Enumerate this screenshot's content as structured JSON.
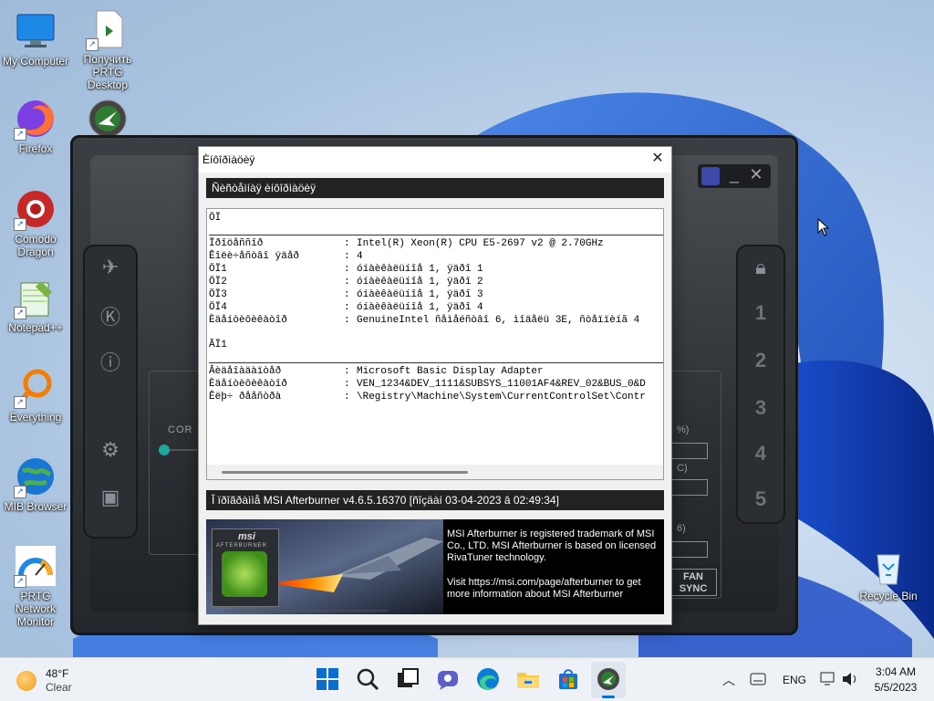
{
  "desktop": {
    "icons": [
      {
        "label": "My Computer"
      },
      {
        "label": "Получить PRTG Desktop"
      },
      {
        "label": "Firefox"
      },
      {
        "label": "Comodo Dragon"
      },
      {
        "label": "Notepad++"
      },
      {
        "label": "Everything"
      },
      {
        "label": "MIB Browser"
      },
      {
        "label": "PRTG Network Monitor"
      },
      {
        "label": "Recycle Bin"
      }
    ]
  },
  "afterburner": {
    "profile_numbers": [
      "1",
      "2",
      "3",
      "4",
      "5"
    ],
    "fan_sync_label": "FAN SYNC",
    "core_label": "COR",
    "pct_label_1": "%)",
    "pct_label_2": "C)",
    "pct_label_3": "6)"
  },
  "dialog": {
    "title": "Èíôîðìàöèÿ",
    "system_header": "Ñèñòåìíàÿ èíôîðìàöèÿ",
    "cpu_section": "ÖÏ",
    "cpu_rows": [
      {
        "key": "Ïðîöåññîð",
        "value": "Intel(R) Xeon(R) CPU E5-2697 v2 @ 2.70GHz"
      },
      {
        "key": "Êîëè÷åñòâî ÿäåð",
        "value": "4"
      },
      {
        "key": "ÖÏ1",
        "value": "óíàèêàëüíîå 1, ÿäðî 1"
      },
      {
        "key": "ÖÏ2",
        "value": "óíàèêàëüíîå 1, ÿäðî 2"
      },
      {
        "key": "ÖÏ3",
        "value": "óíàèêàëüíîå 1, ÿäðî 3"
      },
      {
        "key": "ÖÏ4",
        "value": "óíàèêàëüíîå 1, ÿäðî 4"
      },
      {
        "key": "Èäåíòèôèêàòîð",
        "value": "GenuineIntel ñåìåéñòâî 6, ìîäåëü 3E, ñòåïïèíã 4"
      }
    ],
    "gpu_section": "ÃÏ1",
    "gpu_rows": [
      {
        "key": "Âèäåîàäàïòåð",
        "value": "Microsoft Basic Display Adapter"
      },
      {
        "key": "Èäåíòèôèêàòîð",
        "value": "VEN_1234&DEV_1111&SUBSYS_11001AF4&REV_02&BUS_0&D"
      },
      {
        "key": "Êëþ÷ ðååñòðà",
        "value": "\\Registry\\Machine\\System\\CurrentControlSet\\Contr"
      }
    ],
    "about_header": "Î ïðîãðàììå MSI Afterburner v4.6.5.16370 [ñîçäàí 03-04-2023 â 02:49:34]",
    "banner_text_1": "MSI Afterburner is registered trademark of MSI Co., LTD. MSI Afterburner is based on licensed RivaTuner technology.",
    "banner_text_2": "Visit https://msi.com/page/afterburner to get more information about MSI Afterburner",
    "banner_logo_msi": "msi",
    "banner_logo_name": "AFTERBURNER"
  },
  "taskbar": {
    "weather_temp": "48°F",
    "weather_desc": "Clear",
    "language": "ENG",
    "time": "3:04 AM",
    "date": "5/5/2023"
  }
}
